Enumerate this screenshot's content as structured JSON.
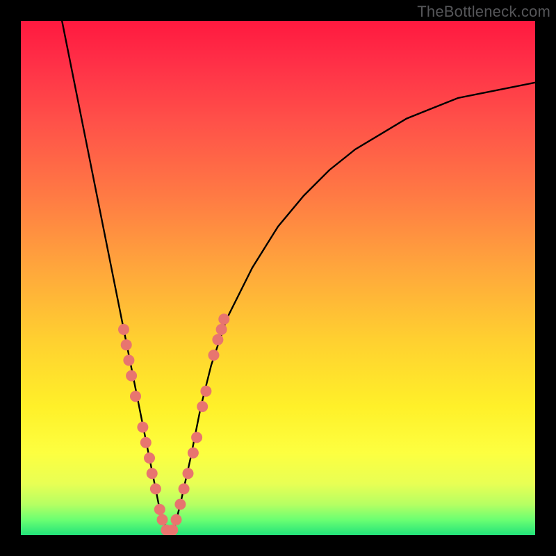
{
  "watermark": "TheBottleneck.com",
  "colors": {
    "accent_marker": "#e8756f",
    "curve": "#000000"
  },
  "chart_data": {
    "type": "line",
    "title": "",
    "xlabel": "",
    "ylabel": "",
    "xlim": [
      0,
      100
    ],
    "ylim": [
      0,
      100
    ],
    "left_curve": {
      "x": [
        8,
        10,
        12,
        14,
        16,
        18,
        20,
        21,
        22,
        23,
        24,
        25,
        26,
        27,
        28,
        29
      ],
      "y": [
        100,
        90,
        80,
        70,
        60,
        50,
        40,
        35,
        30,
        25,
        20,
        15,
        10,
        5,
        2,
        0
      ]
    },
    "right_curve": {
      "x": [
        29,
        30,
        31,
        33,
        35,
        37,
        40,
        45,
        50,
        55,
        60,
        65,
        70,
        75,
        80,
        85,
        90,
        95,
        100
      ],
      "y": [
        0,
        2,
        6,
        15,
        25,
        33,
        42,
        52,
        60,
        66,
        71,
        75,
        78,
        81,
        83,
        85,
        86,
        87,
        88
      ]
    },
    "markers_left": {
      "x": [
        20.0,
        20.5,
        21.0,
        21.5,
        22.3,
        23.7,
        24.3,
        25.0,
        25.5,
        26.2,
        27.0,
        27.5,
        28.3,
        29.0
      ],
      "y": [
        40,
        37,
        34,
        31,
        27,
        21,
        18,
        15,
        12,
        9,
        5,
        3,
        1,
        0
      ]
    },
    "markers_right": {
      "x": [
        29.5,
        30.2,
        31.0,
        31.7,
        32.5,
        33.5,
        34.2,
        35.3,
        36.0,
        37.5,
        38.3,
        39.0,
        39.5
      ],
      "y": [
        1,
        3,
        6,
        9,
        12,
        16,
        19,
        25,
        28,
        35,
        38,
        40,
        42
      ]
    }
  }
}
